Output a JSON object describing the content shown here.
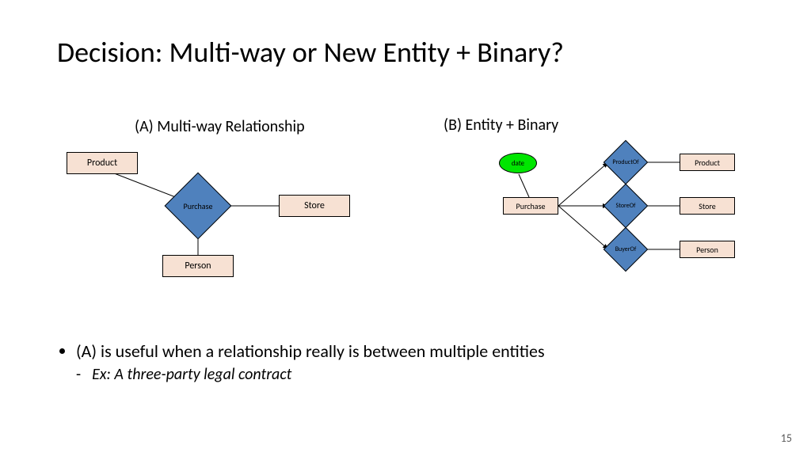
{
  "title": "Decision: Multi-way or New Entity + Binary?",
  "sectionA": {
    "heading": "(A) Multi-way Relationship",
    "entities": {
      "product": "Product",
      "store": "Store",
      "person": "Person"
    },
    "relationship": "Purchase"
  },
  "sectionB": {
    "heading": "(B) Entity + Binary",
    "entity": "Purchase",
    "attribute": "date",
    "relationships": {
      "r1": "ProductOf",
      "r2": "StoreOf",
      "r3": "BuyerOf"
    },
    "targets": {
      "t1": "Product",
      "t2": "Store",
      "t3": "Person"
    }
  },
  "bullets": {
    "main": "(A) is useful when a relationship really is between multiple entities",
    "sub": "Ex: A three-party legal contract"
  },
  "pageNumber": "15"
}
